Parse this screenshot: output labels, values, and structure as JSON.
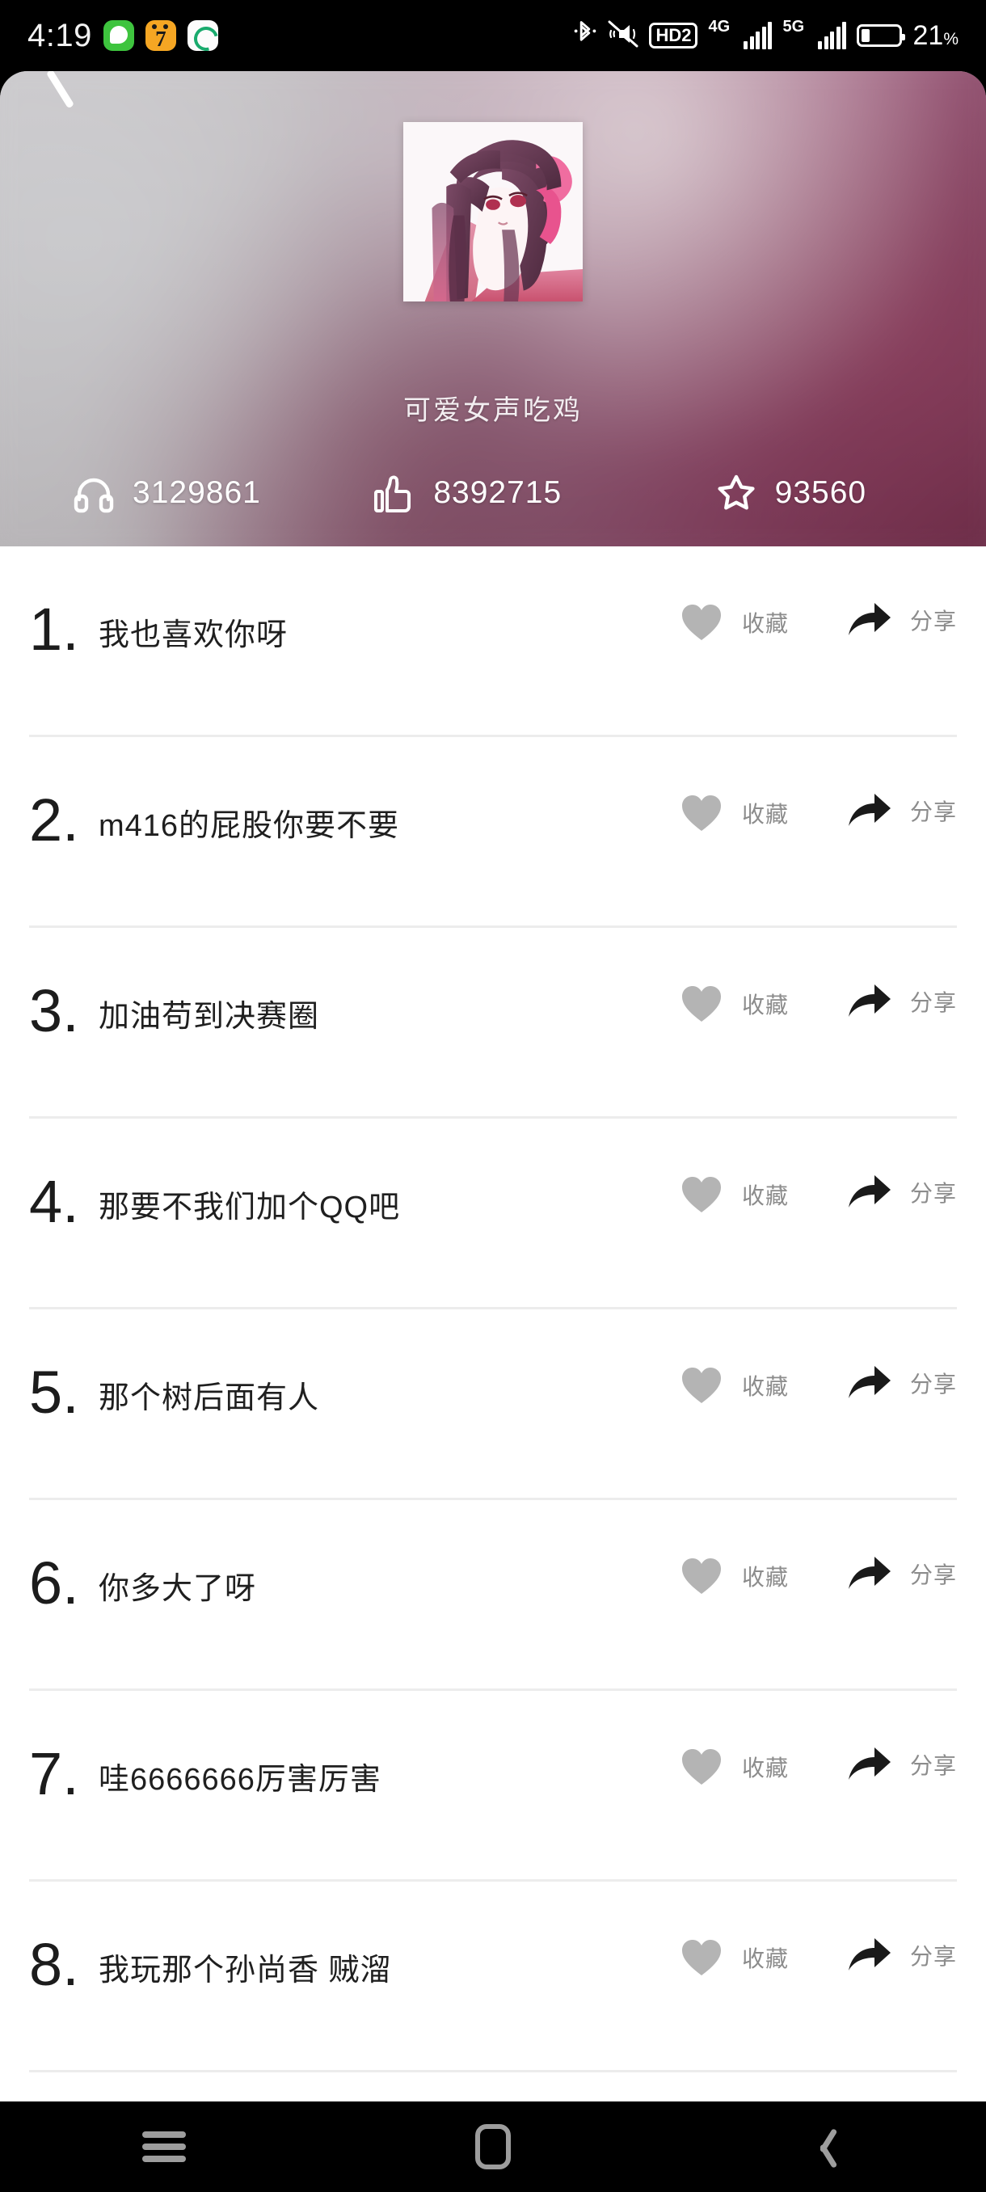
{
  "status_bar": {
    "clock": "4:19",
    "app_icons": [
      "wechat-green-icon",
      "cat-seven-yellow-icon",
      "camera-green-white-icon"
    ],
    "bluetooth_icon": "bluetooth-icon",
    "silent_icon": "mute-vibrate-icon",
    "hd_label": "HD2",
    "network_primary": "4G",
    "network_secondary": "5G",
    "battery_percent": "21",
    "battery_percent_symbol": "%",
    "battery_level": 21
  },
  "header": {
    "back_icon": "back-arrow-icon",
    "cover_alt": "anime-girl-album-cover",
    "title": "可爱女声吃鸡",
    "stats": [
      {
        "icon": "headphones-icon",
        "value": "3129861"
      },
      {
        "icon": "thumbs-up-icon",
        "value": "8392715"
      },
      {
        "icon": "star-outline-icon",
        "value": "93560"
      }
    ]
  },
  "list": {
    "favorite_label": "收藏",
    "share_label": "分享",
    "favorite_icon": "heart-icon",
    "share_icon": "share-arrow-icon",
    "items": [
      {
        "index": "1.",
        "title": "我也喜欢你呀"
      },
      {
        "index": "2.",
        "title": "m416的屁股你要不要"
      },
      {
        "index": "3.",
        "title": "加油苟到决赛圈"
      },
      {
        "index": "4.",
        "title": "那要不我们加个QQ吧"
      },
      {
        "index": "5.",
        "title": "那个树后面有人"
      },
      {
        "index": "6.",
        "title": "你多大了呀"
      },
      {
        "index": "7.",
        "title": "哇6666666厉害厉害"
      },
      {
        "index": "8.",
        "title": "我玩那个孙尚香 贼溜"
      }
    ]
  },
  "nav_bar": {
    "recents_icon": "hamburger-menu-icon",
    "home_icon": "home-square-icon",
    "back_icon": "chevron-left-icon"
  },
  "colors": {
    "heart_grey": "#b4b4b4",
    "label_grey": "#8c8c8c",
    "divider": "#ececec",
    "nav_icon": "#9d9d9d",
    "accent_pink": "#9c5e80"
  }
}
